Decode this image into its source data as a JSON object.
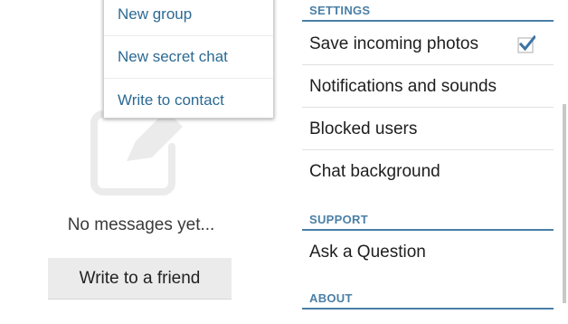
{
  "popup_menu": {
    "items": [
      {
        "label": "New group"
      },
      {
        "label": "New secret chat"
      },
      {
        "label": "Write to contact"
      }
    ]
  },
  "chats": {
    "empty_icon": "compose-pencil-icon",
    "empty_text": "No messages yet...",
    "write_button_label": "Write to a friend"
  },
  "settings": {
    "sections": {
      "settings": "SETTINGS",
      "support": "SUPPORT",
      "about": "ABOUT"
    },
    "rows": {
      "save_photos": {
        "label": "Save incoming photos",
        "checked": true
      },
      "notifications": {
        "label": "Notifications and sounds"
      },
      "blocked": {
        "label": "Blocked users"
      },
      "background": {
        "label": "Chat background"
      },
      "ask": {
        "label": "Ask a Question"
      }
    }
  },
  "colors": {
    "accent": "#4a7fa6",
    "link": "#2c6a94",
    "check": "#3b74a5"
  }
}
